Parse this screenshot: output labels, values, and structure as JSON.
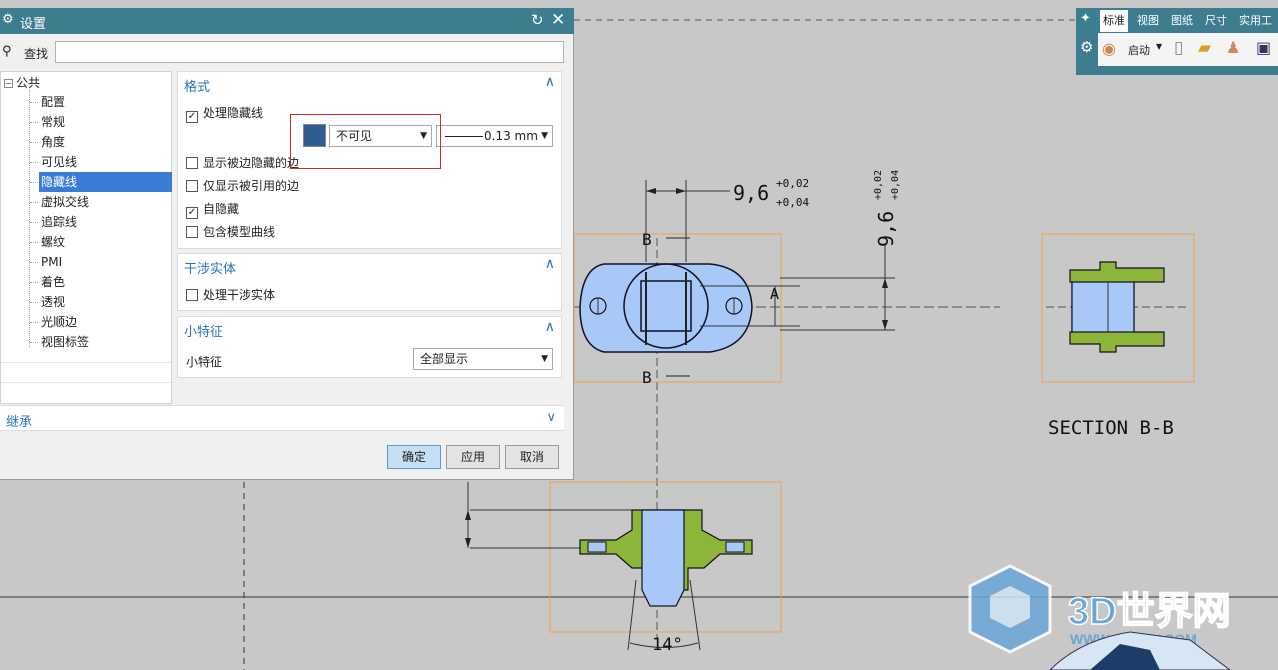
{
  "dialog": {
    "title": "设置",
    "find_label": "查找",
    "find_value": "",
    "tree": {
      "root": "公共",
      "items": [
        "配置",
        "常规",
        "角度",
        "可见线",
        "隐藏线",
        "虚拟交线",
        "追踪线",
        "螺纹",
        "PMI",
        "着色",
        "透视",
        "光顺边",
        "视图标签"
      ],
      "selected": "隐藏线"
    },
    "format": {
      "header": "格式",
      "process_hidden": "处理隐藏线",
      "color": "#2e5d93",
      "style_value": "不可见",
      "width_value": "0.13 mm",
      "opt1": "显示被边隐藏的边",
      "opt2": "仅显示被引用的边",
      "opt3": "自隐藏",
      "opt4": "包含模型曲线",
      "checked": [
        true,
        false,
        false,
        true,
        false
      ]
    },
    "interference": {
      "header": "干涉实体",
      "label": "处理干涉实体",
      "checked": false
    },
    "small": {
      "header": "小特征",
      "label": "小特征",
      "value": "全部显示"
    },
    "inherit": "继承",
    "buttons": {
      "ok": "确定",
      "apply": "应用",
      "cancel": "取消"
    }
  },
  "toolbar": {
    "tabs": [
      "标准",
      "视图",
      "图纸",
      "尺寸",
      "实用工"
    ],
    "active_tab": "标准",
    "start_label": "启动"
  },
  "drawing": {
    "dim_horizontal": "9,6",
    "dim_h_tol_upper": "+0,02",
    "dim_h_tol_lower": "+0,04",
    "dim_vertical": "9,6",
    "dim_v_tol_upper": "+0,02",
    "dim_v_tol_lower": "+0,04",
    "label_a": "A",
    "label_b": "B",
    "section_title": "SECTION B-B",
    "angle": "14°",
    "watermark": "3D世界网",
    "watermark_url": "WWW.3DSJW.COM",
    "blue": "#a8c8f8",
    "green": "#8db53a",
    "orange": "#f0a050"
  }
}
